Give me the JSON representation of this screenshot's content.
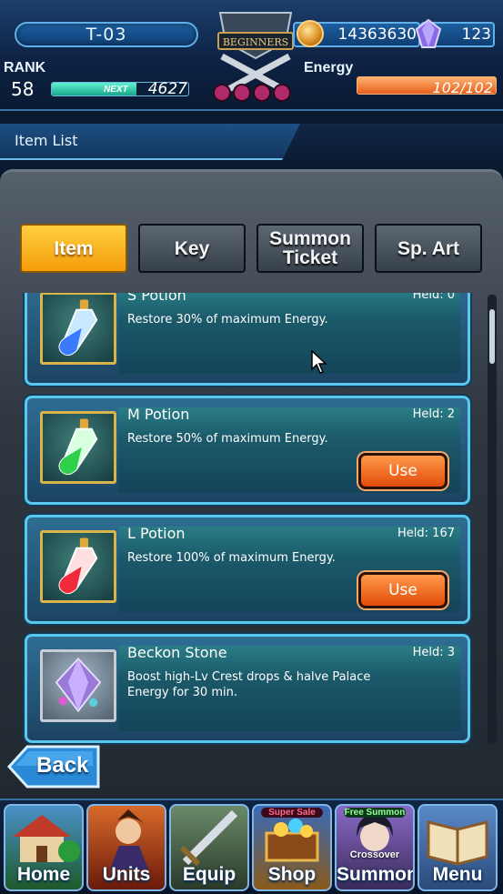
{
  "hud": {
    "stage": "T-03",
    "crest_text": "BEGINNERS",
    "coins": "14363630",
    "gems": "123",
    "rank_label": "RANK",
    "rank": "58",
    "next_label": "NEXT",
    "next_exp": "4627",
    "exp_progress": 0.62,
    "energy_label": "Energy",
    "energy": "102/102",
    "energy_progress": 1.0
  },
  "section": {
    "title": "Item List"
  },
  "tabs": [
    {
      "label": "Item",
      "active": true
    },
    {
      "label": "Key",
      "active": false
    },
    {
      "label": "Summon Ticket",
      "active": false
    },
    {
      "label": "Sp. Art",
      "active": false
    }
  ],
  "items": [
    {
      "name": "S Potion",
      "held": "Held: 0",
      "desc": "Restore 30% of maximum Energy.",
      "use_label": ""
    },
    {
      "name": "M Potion",
      "held": "Held: 2",
      "desc": "Restore 50% of maximum Energy.",
      "use_label": "Use"
    },
    {
      "name": "L Potion",
      "held": "Held: 167",
      "desc": "Restore 100% of maximum Energy.",
      "use_label": "Use"
    },
    {
      "name": "Beckon Stone",
      "held": "Held: 3",
      "desc": "Boost high-Lv Crest drops & halve Palace Energy for 30 min.",
      "use_label": ""
    }
  ],
  "back_label": "Back",
  "nav": [
    {
      "label": "Home",
      "badge": "",
      "sub": ""
    },
    {
      "label": "Units",
      "badge": "",
      "sub": ""
    },
    {
      "label": "Equip",
      "badge": "",
      "sub": ""
    },
    {
      "label": "Shop",
      "badge": "Super Sale",
      "sub": ""
    },
    {
      "label": "Summon",
      "badge": "Free Summon",
      "sub": "Crossover"
    },
    {
      "label": "Menu",
      "badge": "",
      "sub": ""
    }
  ],
  "colors": {
    "accent": "#58c8f0",
    "active_tab": "#f59c0a",
    "use_button": "#e24c0a",
    "exp_bar": "#1aa68a",
    "energy_bar": "#e6601c"
  }
}
